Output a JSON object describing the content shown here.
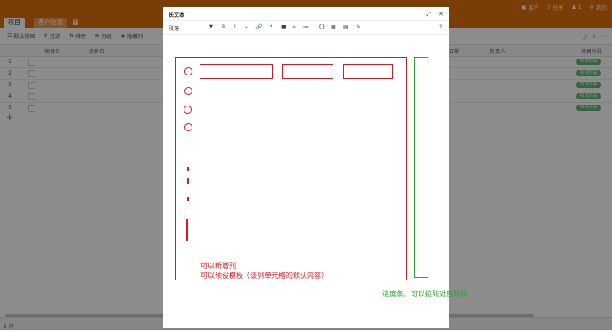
{
  "app": {
    "doc_title": "",
    "top_actions": [
      "客户",
      "分享",
      "1",
      "我的"
    ],
    "tabs": {
      "active": "项目",
      "second": "客户信息",
      "add": "+"
    }
  },
  "toolbar": {
    "items": [
      "默认视图",
      "过滤",
      "排序",
      "分组",
      "隐藏列"
    ]
  },
  "grid": {
    "headers": [
      "项目名",
      "项目名",
      "日期",
      "负责人",
      "项目阶段"
    ],
    "rows": [
      {
        "num": "1",
        "badge": "项目阶段"
      },
      {
        "num": "2",
        "badge": "项目阶段"
      },
      {
        "num": "3",
        "badge": "项目阶段"
      },
      {
        "num": "4",
        "badge": "项目阶段"
      },
      {
        "num": "5",
        "badge": "项目阶段"
      }
    ],
    "add_row": "+",
    "status_text": "5 行"
  },
  "modal": {
    "title": "长文本",
    "paragraph_select": "段落",
    "format_buttons": [
      "B",
      "I",
      "⌁",
      "🔗",
      "❝",
      "■",
      "≡",
      "≔",
      "{}",
      "▦",
      "▤",
      "✎"
    ],
    "help": "?"
  },
  "annotations": {
    "red_note_line1": "可以新增列",
    "red_note_line2": "可以预设模板（该列单元格的默认内容）",
    "green_note": "进度条，可以拉到对应阶段"
  }
}
